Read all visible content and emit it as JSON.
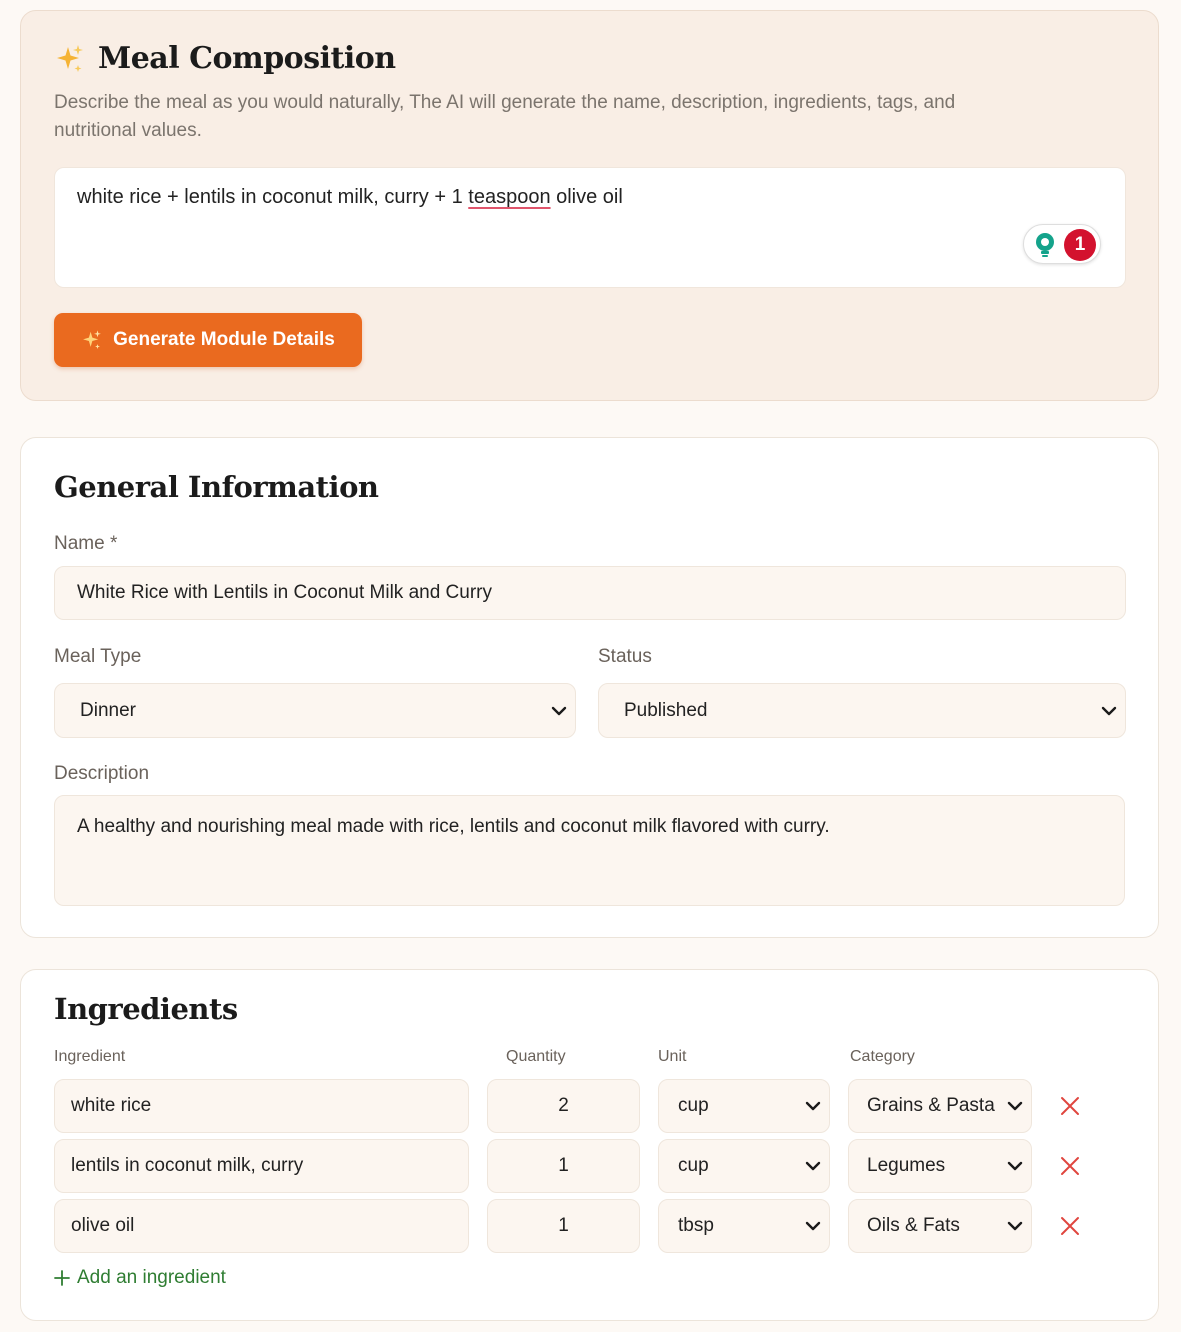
{
  "composition": {
    "title": "Meal Composition",
    "subtitle": "Describe the meal as you would naturally, The AI will generate the name, description, ingredients, tags, and nutritional values.",
    "prompt_before": "white rice + lentils in coconut milk, curry + 1 ",
    "prompt_flagged": "teaspoon",
    "prompt_after": " olive oil",
    "grammar_count": "1",
    "generate_label": "Generate Module Details"
  },
  "general": {
    "title": "General Information",
    "name_label": "Name *",
    "name_value": "White Rice with Lentils in Coconut Milk and Curry",
    "meal_type_label": "Meal Type",
    "meal_type_value": "Dinner",
    "status_label": "Status",
    "status_value": "Published",
    "description_label": "Description",
    "description_value": "A healthy and nourishing meal made with rice, lentils and coconut milk flavored with curry."
  },
  "ingredients": {
    "title": "Ingredients",
    "headers": {
      "ingredient": "Ingredient",
      "quantity": "Quantity",
      "unit": "Unit",
      "category": "Category"
    },
    "rows": [
      {
        "name": "white rice",
        "quantity": "2",
        "unit": "cup",
        "category": "Grains & Pasta"
      },
      {
        "name": "lentils in coconut milk, curry",
        "quantity": "1",
        "unit": "cup",
        "category": "Legumes"
      },
      {
        "name": "olive oil",
        "quantity": "1",
        "unit": "tbsp",
        "category": "Oils & Fats"
      }
    ],
    "add_label": "Add an ingredient"
  },
  "colors": {
    "accent": "#ea6a1f",
    "delete": "#e0463f",
    "add": "#2f7d32",
    "badge": "#d3122e"
  }
}
